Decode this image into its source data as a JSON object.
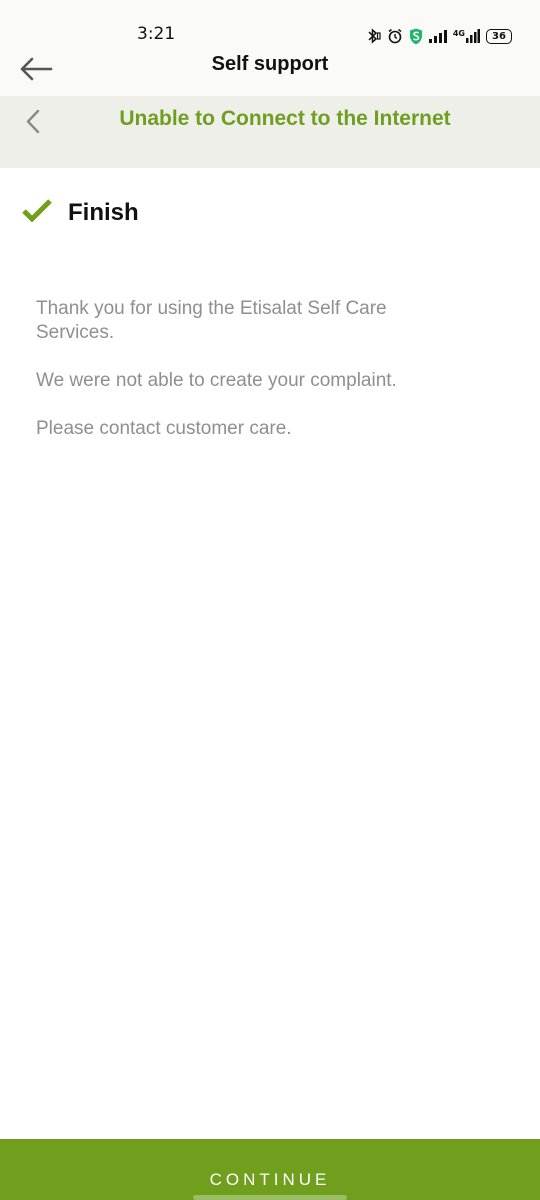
{
  "status_bar": {
    "time": "3:21",
    "battery_level": "36",
    "network_type": "4G",
    "icons": [
      "bluetooth-icon",
      "alarm-icon",
      "vpn-shield-icon",
      "signal-icon",
      "signal-4g-icon",
      "battery-icon"
    ]
  },
  "app_bar": {
    "title": "Self support",
    "back_icon": "arrow-left-icon"
  },
  "sub_header": {
    "title": "Unable to Connect to the Internet",
    "back_icon": "chevron-left-icon"
  },
  "finish": {
    "title": "Finish",
    "icon": "checkmark-icon"
  },
  "messages": [
    "Thank you for using the Etisalat Self Care Services.",
    "We were not able to create your complaint.",
    "Please contact customer care."
  ],
  "continue_button": {
    "label": "CONTINUE"
  },
  "colors": {
    "accent_green": "#6f9f1c",
    "title_green": "#6e9e22",
    "sub_header_bg": "#efefe9",
    "message_text": "#8f8f8f"
  }
}
